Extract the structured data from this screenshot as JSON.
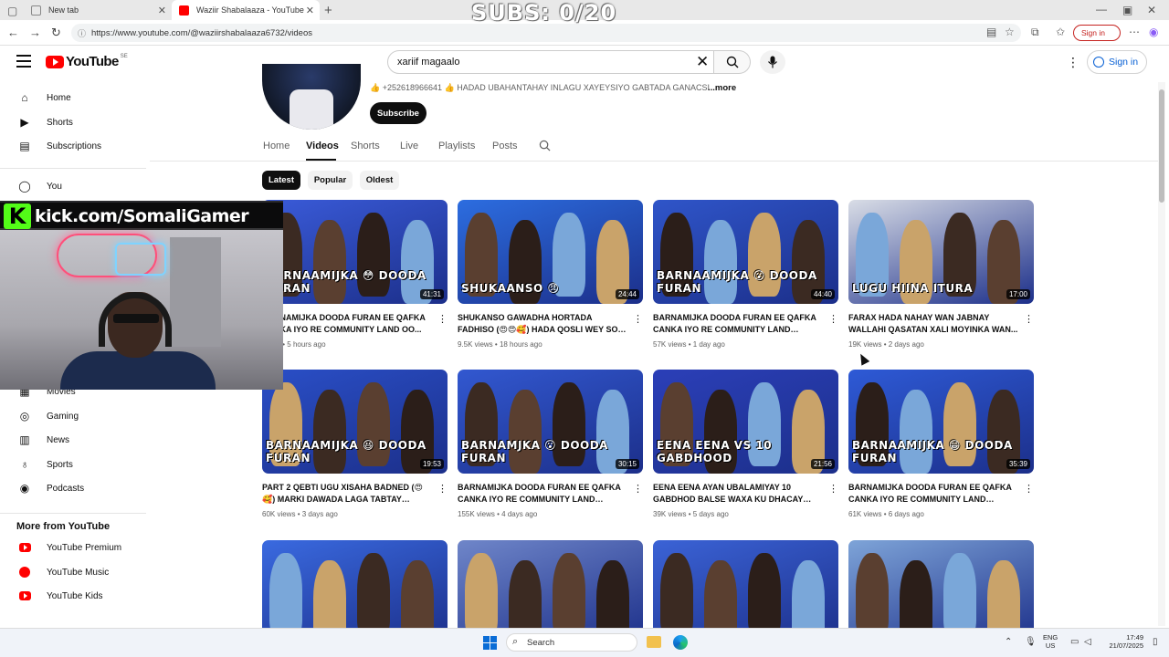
{
  "overlay": {
    "subs_counter": "SUBS: 0/20",
    "kick_letter": "K",
    "kick_text": "kick.com/SomaliGamer"
  },
  "browser": {
    "tabs": [
      {
        "title": "New tab"
      },
      {
        "title": "Waziir Shabalaaza - YouTube"
      }
    ],
    "url": "https://www.youtube.com/@waziirshabalaaza6732/videos",
    "signin_label": "Sign in"
  },
  "header": {
    "logo_text": "YouTube",
    "region": "SE",
    "search_value": "xariif magaalo",
    "signin_label": "Sign in"
  },
  "sidebar": {
    "items": [
      {
        "label": "Home",
        "icon": "home-icon"
      },
      {
        "label": "Shorts",
        "icon": "shorts-icon"
      },
      {
        "label": "Subscriptions",
        "icon": "subscriptions-icon"
      },
      {
        "label": "You",
        "icon": "you-icon"
      },
      {
        "label": "Movies",
        "icon": "movies-icon"
      },
      {
        "label": "Gaming",
        "icon": "gaming-icon"
      },
      {
        "label": "News",
        "icon": "news-icon"
      },
      {
        "label": "Sports",
        "icon": "sports-icon"
      },
      {
        "label": "Podcasts",
        "icon": "podcasts-icon"
      }
    ],
    "more_heading": "More from YouTube",
    "more_items": [
      {
        "label": "YouTube Premium"
      },
      {
        "label": "YouTube Music"
      },
      {
        "label": "YouTube Kids"
      }
    ]
  },
  "channel": {
    "about": "👍 +252618966641 👍 HADAD UBAHANTAHAY INLAGU XAYEYSIYO GABTADA GANACSI",
    "about_more": "...more",
    "subscribe_label": "Subscribe",
    "tabs": [
      "Home",
      "Videos",
      "Shorts",
      "Live",
      "Playlists",
      "Posts"
    ],
    "active_tab": "Videos",
    "chips": [
      "Latest",
      "Popular",
      "Oldest"
    ],
    "active_chip": "Latest"
  },
  "videos": [
    {
      "title": "BARNAMIJKA DOODA FURAN EE QAFKA CANKA IYO RE COMMUNITY LAND OO...",
      "views": "views",
      "age": "5 hours ago",
      "duration": "41:31",
      "caption": "BARNAAMIJKA 😳 DOODA FURAN",
      "bg": "#3a5bd9"
    },
    {
      "title": "SHUKANSO GAWADHA HORTADA FADHISO (😍😍🥰) HADA QOSLI WEY SO WAD...",
      "views": "9.5K views",
      "age": "18 hours ago",
      "duration": "24:44",
      "caption": "SHUKAANSO 😠",
      "bg": "#2c6de0"
    },
    {
      "title": "BARNAMIJKA DOODA FURAN EE QAFKA CANKA IYO RE COMMUNITY LAND KUWAN...",
      "views": "57K views",
      "age": "1 day ago",
      "duration": "44:40",
      "caption": "BARNAAMIJKA 😮 DOODA FURAN",
      "bg": "#2f55c9"
    },
    {
      "title": "FARAX HADA NAHAY WAN JABNAY WALLAHI QASATAN XALI MOYINKA WAN...",
      "views": "19K views",
      "age": "2 days ago",
      "duration": "17:00",
      "caption": "LUGU HIINA ITURA",
      "bg": "#d9dde6"
    },
    {
      "title": "PART 2 QEBTI UGU XISAHA BADNED (😍🥰) MARKI DAWADA LAGA TABTAY MAXA...",
      "views": "60K views",
      "age": "3 days ago",
      "duration": "19:53",
      "caption": "BARNAAMIJKA 😆 DOODA FURAN",
      "bg": "#2a4fc7"
    },
    {
      "title": "BARNAMIJKA DOODA FURAN EE QAFKA CANKA IYO RE COMMUNITY LAND WAXA...",
      "views": "155K views",
      "age": "4 days ago",
      "duration": "30:15",
      "caption": "BARNAMJKA 😮 DOODA FURAN",
      "bg": "#3258d0"
    },
    {
      "title": "EENA EENA AYAN UBALAMIYAY 10 GABDHOD BALSE WAXA KU DHACAY (😍...",
      "views": "39K views",
      "age": "5 days ago",
      "duration": "21:56",
      "caption": "EENA EENA VS 10 GABDHOOD",
      "bg": "#2b3fb8"
    },
    {
      "title": "BARNAMIJKA DOODA FURAN EE QAFKA CANKA IYO RE COMMUNITY LAND WALLE...",
      "views": "61K views",
      "age": "6 days ago",
      "duration": "35:39",
      "caption": "BARNAAMIJKA 😁 DOODA FURAN",
      "bg": "#2e5ad6"
    },
    {
      "title": "",
      "views": "",
      "age": "",
      "duration": "",
      "caption": "",
      "bg": "#3a6ae0"
    },
    {
      "title": "",
      "views": "",
      "age": "",
      "duration": "",
      "caption": "",
      "bg": "#6f86c9"
    },
    {
      "title": "",
      "views": "",
      "age": "",
      "duration": "",
      "caption": "",
      "bg": "#3b63d6"
    },
    {
      "title": "",
      "views": "",
      "age": "",
      "duration": "",
      "caption": "",
      "bg": "#7ea4d8"
    }
  ],
  "taskbar": {
    "search_placeholder": "Search",
    "lang_top": "ENG",
    "lang_bottom": "US",
    "time": "17:49",
    "date": "21/07/2025"
  }
}
